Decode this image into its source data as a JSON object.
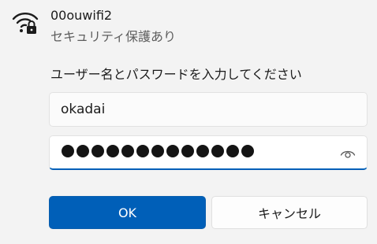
{
  "network": {
    "ssid": "00ouwifi2",
    "security": "セキュリティ保護あり",
    "icon": "wifi-locked-icon"
  },
  "form": {
    "prompt": "ユーザー名とパスワードを入力してください",
    "username_value": "okadai",
    "password_masked": "●●●●●●●●●●●●●",
    "password_length": 13,
    "reveal_icon": "eye-icon"
  },
  "buttons": {
    "ok_label": "OK",
    "cancel_label": "キャンセル"
  },
  "colors": {
    "accent": "#005fb8",
    "background": "#f3f3f3"
  }
}
